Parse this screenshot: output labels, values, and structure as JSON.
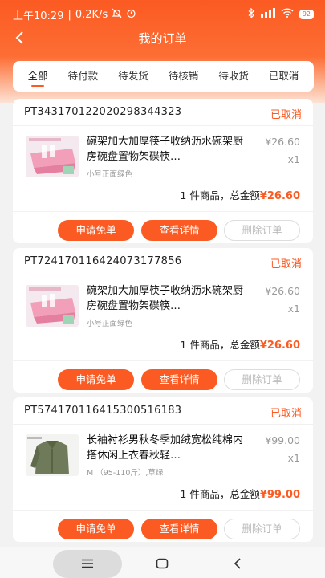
{
  "status_bar": {
    "time": "上午10:29",
    "speed": "0.2K/s",
    "battery": "92"
  },
  "header": {
    "title": "我的订单"
  },
  "tabs": [
    {
      "label": "全部",
      "active": true
    },
    {
      "label": "待付款",
      "active": false
    },
    {
      "label": "待发货",
      "active": false
    },
    {
      "label": "待核销",
      "active": false
    },
    {
      "label": "待收货",
      "active": false
    },
    {
      "label": "已取消",
      "active": false
    }
  ],
  "orders": [
    {
      "order_no": "PT343170122020298344323",
      "status": "已取消",
      "product_name": "碗架加大加厚筷子收纳沥水碗架厨房碗盘置物架碟筷…",
      "spec": "小号正面绿色",
      "price": "¥26.60",
      "qty": "x1",
      "summary_prefix": "1 件商品，总金额",
      "total": "¥26.60",
      "buttons": {
        "free": "申请免单",
        "detail": "查看详情",
        "delete": "删除订单"
      }
    },
    {
      "order_no": "PT724170116424073177856",
      "status": "已取消",
      "product_name": "碗架加大加厚筷子收纳沥水碗架厨房碗盘置物架碟筷…",
      "spec": "小号正面绿色",
      "price": "¥26.60",
      "qty": "x1",
      "summary_prefix": "1 件商品，总金额",
      "total": "¥26.60",
      "buttons": {
        "free": "申请免单",
        "detail": "查看详情",
        "delete": "删除订单"
      }
    },
    {
      "order_no": "PT574170116415300516183",
      "status": "已取消",
      "product_name": "长袖衬衫男秋冬季加绒宽松纯棉内搭休闲上衣春秋轻…",
      "spec": "M （95-110斤）,草绿",
      "price": "¥99.00",
      "qty": "x1",
      "summary_prefix": "1 件商品，总金额",
      "total": "¥99.00",
      "buttons": {
        "free": "申请免单",
        "detail": "查看详情",
        "delete": "删除订单"
      }
    }
  ],
  "colors": {
    "accent": "#fb5a22",
    "muted": "#999999"
  }
}
